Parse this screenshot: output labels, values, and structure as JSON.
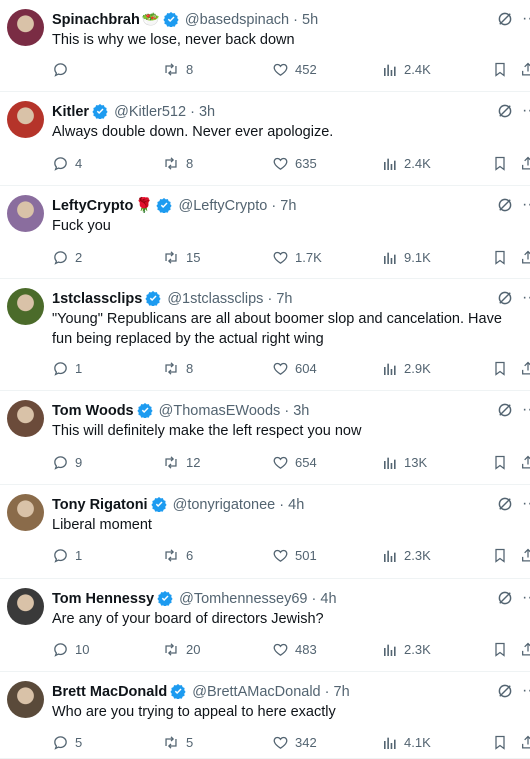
{
  "tweets": [
    {
      "name": "Spinachbrah",
      "emoji": "🥗",
      "handle": "@basedspinach",
      "dot": "·",
      "time": "5h",
      "text": "This is why we lose, never back down",
      "replies": "",
      "retweets": "8",
      "likes": "452",
      "views": "2.4K",
      "avatar_color": "#7a2c44"
    },
    {
      "name": "Kitler",
      "emoji": "",
      "handle": "@Kitler512",
      "dot": "·",
      "time": "3h",
      "text": "Always double down. Never ever apologize.",
      "replies": "4",
      "retweets": "8",
      "likes": "635",
      "views": "2.4K",
      "avatar_color": "#b5342a"
    },
    {
      "name": "LeftyCrypto",
      "emoji": "🌹",
      "handle": "@LeftyCrypto",
      "dot": "·",
      "time": "7h",
      "text": "Fuck you",
      "replies": "2",
      "retweets": "15",
      "likes": "1.7K",
      "views": "9.1K",
      "avatar_color": "#8a6d9e"
    },
    {
      "name": "1stclassclips",
      "emoji": "",
      "handle": "@1stclassclips",
      "dot": "·",
      "time": "7h",
      "text": "\"Young\" Republicans are all about boomer slop and cancelation. Have fun being replaced by the actual right wing",
      "replies": "1",
      "retweets": "8",
      "likes": "604",
      "views": "2.9K",
      "avatar_color": "#4b6b2a"
    },
    {
      "name": "Tom Woods",
      "emoji": "",
      "handle": "@ThomasEWoods",
      "dot": "·",
      "time": "3h",
      "text": "This will definitely make the left respect you now",
      "replies": "9",
      "retweets": "12",
      "likes": "654",
      "views": "13K",
      "avatar_color": "#6b4b3a"
    },
    {
      "name": "Tony Rigatoni",
      "emoji": "",
      "handle": "@tonyrigatonee",
      "dot": "·",
      "time": "4h",
      "text": "Liberal moment",
      "replies": "1",
      "retweets": "6",
      "likes": "501",
      "views": "2.3K",
      "avatar_color": "#8a6b4a"
    },
    {
      "name": "Tom Hennessy",
      "emoji": "",
      "handle": "@Tomhennessey69",
      "dot": "·",
      "time": "4h",
      "text": "Are any of your board of directors Jewish?",
      "replies": "10",
      "retweets": "20",
      "likes": "483",
      "views": "2.3K",
      "avatar_color": "#3a3a3a"
    },
    {
      "name": "Brett MacDonald",
      "emoji": "",
      "handle": "@BrettAMacDonald",
      "dot": "·",
      "time": "7h",
      "text": "Who are you trying to appeal to here exactly",
      "replies": "5",
      "retweets": "5",
      "likes": "342",
      "views": "4.1K",
      "avatar_color": "#5a4a3a"
    }
  ],
  "colors": {
    "verified": "#1d9bf0",
    "muted": "#536471",
    "text": "#0f1419",
    "divider": "#eff3f4"
  }
}
